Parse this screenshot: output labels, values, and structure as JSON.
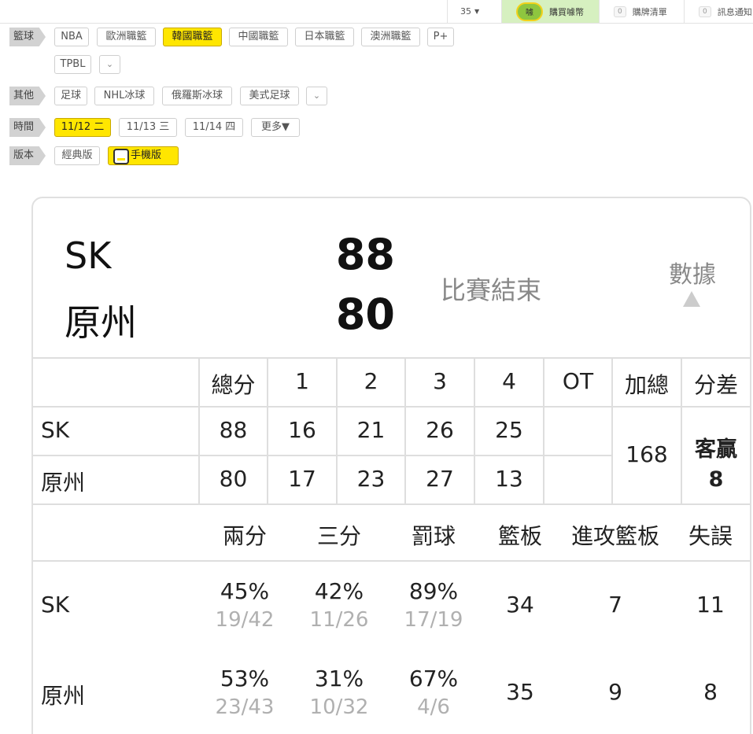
{
  "topbar": {
    "count": "35",
    "buy_coin": "購買噱幣",
    "coin_glyph": "噱",
    "list_count": "0",
    "list_label": "購牌清單",
    "notice_count": "0",
    "notice_label": "訊息通知"
  },
  "filters": {
    "basketball": {
      "label": "籃球",
      "chips": [
        "NBA",
        "歐洲職籃",
        "韓國職籃",
        "中國職籃",
        "日本職籃",
        "澳洲職籃",
        "P+",
        "TPBL"
      ],
      "active": "韓國職籃"
    },
    "other": {
      "label": "其他",
      "chips": [
        "足球",
        "NHL冰球",
        "俄羅斯冰球",
        "美式足球"
      ]
    },
    "time": {
      "label": "時間",
      "chips": [
        "11/12 二",
        "11/13 三",
        "11/14 四",
        "更多▼"
      ],
      "active": "11/12 二"
    },
    "version": {
      "label": "版本",
      "classic": "經典版",
      "mobile": "手機版"
    }
  },
  "game": {
    "away_team": "SK",
    "home_team": "原州",
    "away_score": "88",
    "home_score": "80",
    "status": "比賽結束",
    "stats_label": "數據"
  },
  "boxscore": {
    "headers": [
      "總分",
      "1",
      "2",
      "3",
      "4",
      "OT",
      "加總",
      "分差"
    ],
    "rows": [
      {
        "team": "SK",
        "total": "88",
        "q": [
          "16",
          "21",
          "26",
          "25"
        ],
        "ot": ""
      },
      {
        "team": "原州",
        "total": "80",
        "q": [
          "17",
          "23",
          "27",
          "13"
        ],
        "ot": ""
      }
    ],
    "sum": "168",
    "diff_label": "客贏",
    "diff_value": "8"
  },
  "teamstats": {
    "headers": [
      "兩分",
      "三分",
      "罰球",
      "籃板",
      "進攻籃板",
      "失誤"
    ],
    "rows": [
      {
        "team": "SK",
        "two_pct": "45%",
        "two_made": "19/42",
        "three_pct": "42%",
        "three_made": "11/26",
        "ft_pct": "89%",
        "ft_made": "17/19",
        "reb": "34",
        "oreb": "7",
        "to": "11"
      },
      {
        "team": "原州",
        "two_pct": "53%",
        "two_made": "23/43",
        "three_pct": "31%",
        "three_made": "10/32",
        "ft_pct": "67%",
        "ft_made": "4/6",
        "reb": "35",
        "oreb": "9",
        "to": "8"
      }
    ]
  },
  "colors": {
    "active_chip": "#ffe600",
    "buy_bg": "#d6f0c0",
    "coin": "#8ec63f"
  }
}
